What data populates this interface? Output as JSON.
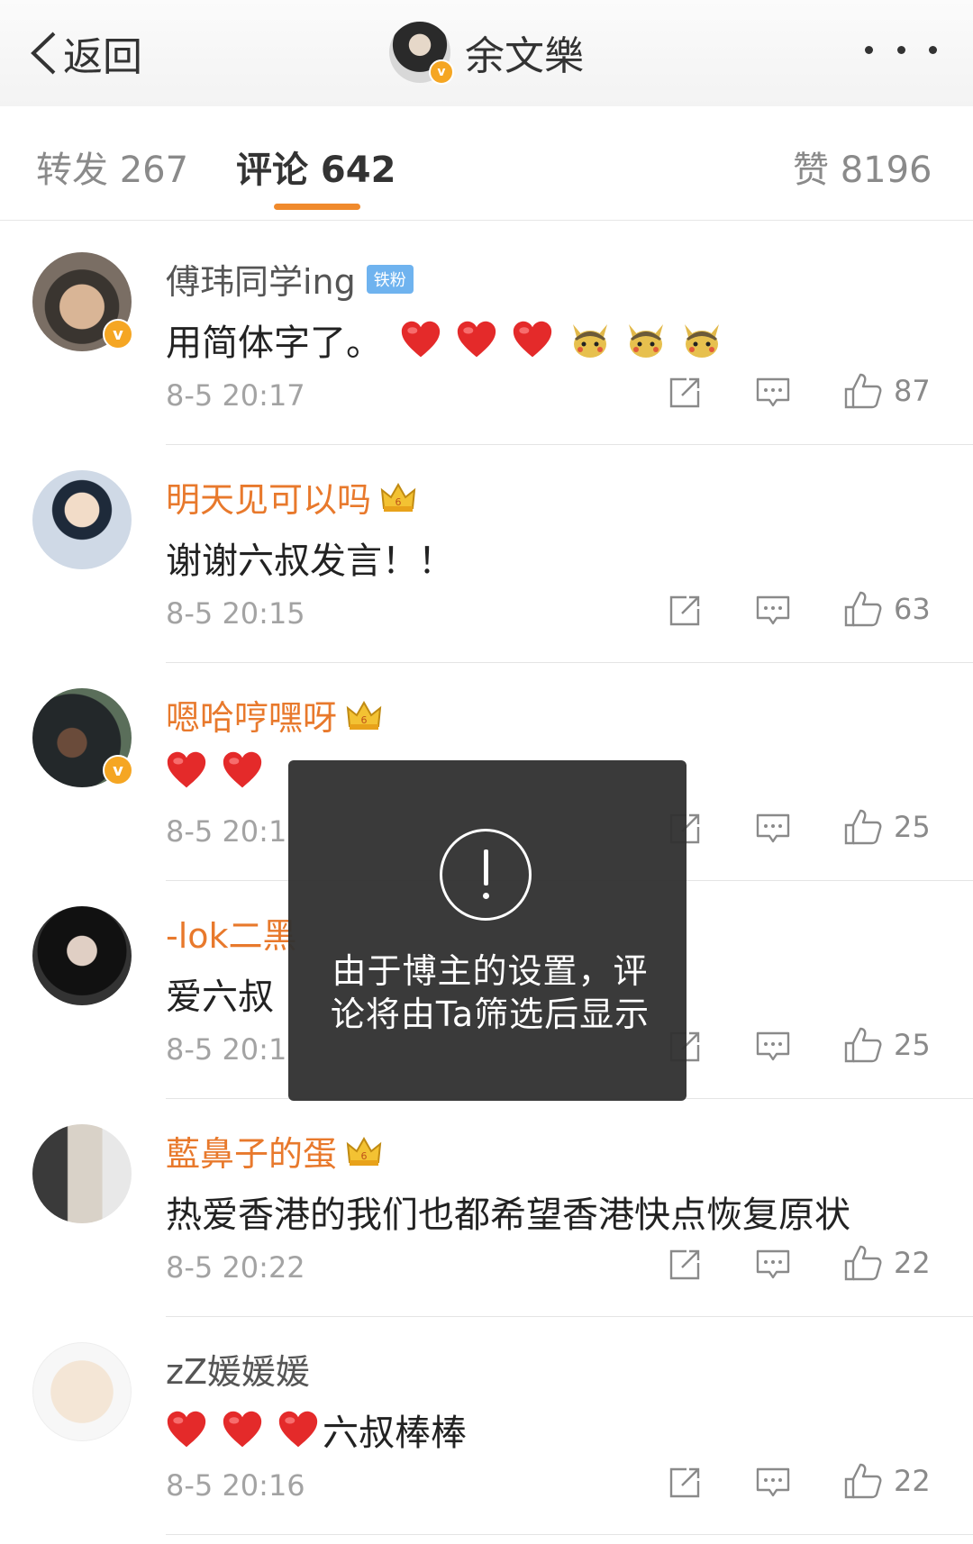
{
  "nav": {
    "back_label": "返回",
    "title": "余文樂"
  },
  "tabs": {
    "repost": "转发 267",
    "comments": "评论 642",
    "likes": "赞 8196"
  },
  "fan_badge": "铁粉",
  "comments": [
    {
      "user": "傅玮同学ing",
      "text": "用简体字了。",
      "time": "8-5 20:17",
      "likes": "87"
    },
    {
      "user": "明天见可以吗",
      "text": "谢谢六叔发言！！",
      "time": "8-5 20:15",
      "likes": "63"
    },
    {
      "user": "嗯哈哼嘿呀",
      "text": "",
      "time": "8-5 20:1",
      "likes": "25"
    },
    {
      "user": "-lok二黑",
      "text": "爱六叔",
      "time": "8-5 20:1",
      "likes": "25"
    },
    {
      "user": "藍鼻子的蛋",
      "text": "热爱香港的我们也都希望香港快点恢复原状",
      "time": "8-5 20:22",
      "likes": "22"
    },
    {
      "user": "zZ媛媛媛",
      "text": "六叔棒棒",
      "time": "8-5 20:16",
      "likes": "22"
    }
  ],
  "toast": {
    "message": "由于博主的设置，评论将由Ta筛选后显示"
  },
  "colors": {
    "vip_name": "#e8792c",
    "tab_underline": "#f08a2c",
    "heart": "#e82a2a",
    "verified": "#f5a623"
  }
}
